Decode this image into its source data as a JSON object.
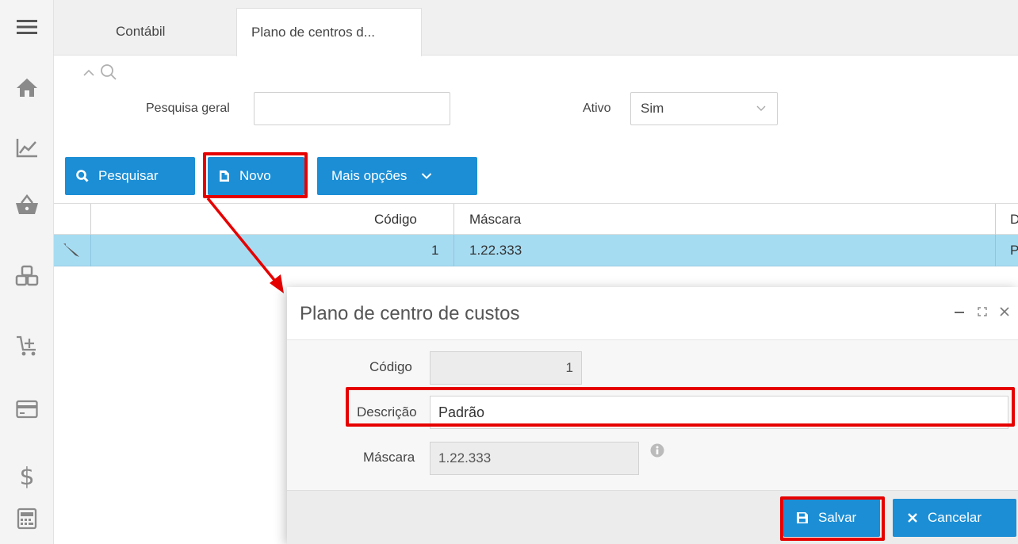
{
  "tabs": [
    {
      "label": "Contábil"
    },
    {
      "label": "Plano de centros d..."
    }
  ],
  "search": {
    "general_label": "Pesquisa geral",
    "general_value": "",
    "active_label": "Ativo",
    "active_value": "Sim"
  },
  "toolbar": {
    "search_label": "Pesquisar",
    "new_label": "Novo",
    "more_label": "Mais opções"
  },
  "grid": {
    "columns": [
      "Código",
      "Máscara",
      "D"
    ],
    "rows": [
      {
        "codigo": "1",
        "mascara": "1.22.333",
        "descricao": "P"
      }
    ]
  },
  "dialog": {
    "title": "Plano de centro de custos",
    "fields": {
      "codigo_label": "Código",
      "codigo_value": "1",
      "descricao_label": "Descrição",
      "descricao_value": "Padrão",
      "mascara_label": "Máscara",
      "mascara_value": "1.22.333"
    },
    "save_label": "Salvar",
    "cancel_label": "Cancelar"
  },
  "colors": {
    "primary": "#1b8ed5",
    "highlight": "#e60000",
    "selected_row": "#a6dcf2"
  },
  "icons": [
    "menu-icon",
    "home-icon",
    "chart-icon",
    "basket-icon",
    "boxes-icon",
    "cart-add-icon",
    "card-icon",
    "dollar-icon",
    "calculator-icon"
  ]
}
